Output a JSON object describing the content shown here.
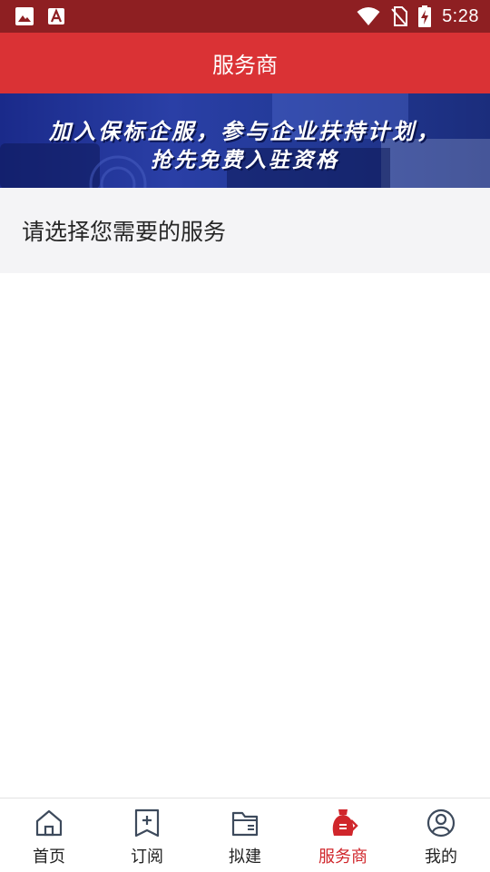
{
  "status_bar": {
    "time": "5:28"
  },
  "header": {
    "title": "服务商"
  },
  "banner": {
    "line1": "加入保标企服，参与企业扶持计划，",
    "line2": "抢先免费入驻资格"
  },
  "section": {
    "prompt": "请选择您需要的服务"
  },
  "tabs": [
    {
      "label": "首页",
      "icon": "home-icon"
    },
    {
      "label": "订阅",
      "icon": "subscribe-icon"
    },
    {
      "label": "拟建",
      "icon": "folder-icon"
    },
    {
      "label": "服务商",
      "icon": "service-provider-icon",
      "active": true
    },
    {
      "label": "我的",
      "icon": "profile-icon"
    }
  ],
  "colors": {
    "status_bar": "#8e1f22",
    "header": "#da3235",
    "accent": "#d0262b",
    "section_bg": "#f4f4f6"
  }
}
